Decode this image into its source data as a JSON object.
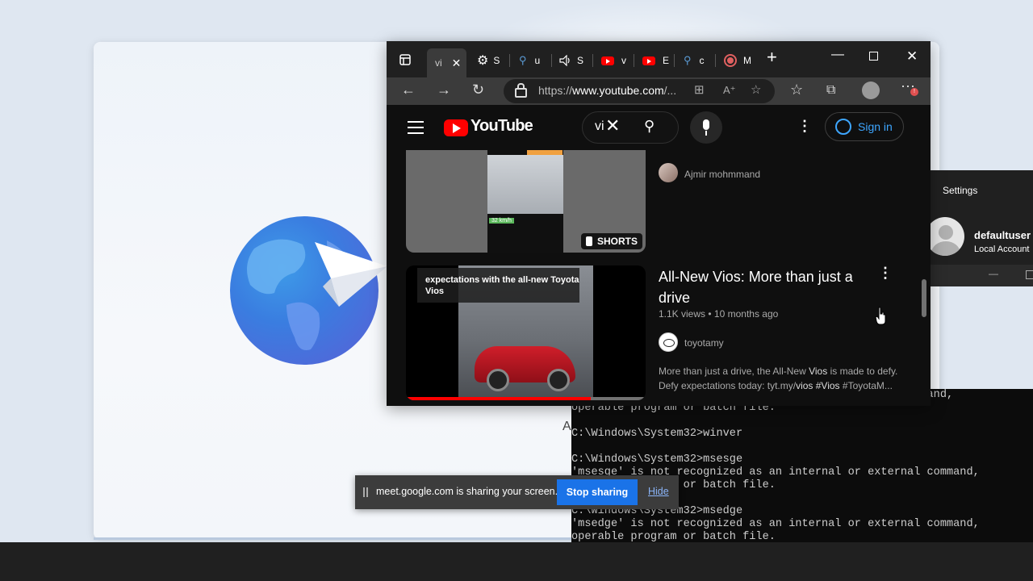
{
  "browser": {
    "tabs": [
      {
        "label": "vi",
        "icon": "youtube-tab-favicon",
        "active": true
      },
      {
        "label": "S",
        "icon": "gear-icon"
      },
      {
        "label": "u",
        "icon": "search-icon"
      },
      {
        "label": "S",
        "icon": "speaker-icon"
      },
      {
        "label": "v",
        "icon": "youtube-icon"
      },
      {
        "label": "E",
        "icon": "youtube-icon"
      },
      {
        "label": "c",
        "icon": "search-icon"
      },
      {
        "label": "M",
        "icon": "record-icon"
      }
    ],
    "address": {
      "prefix": "https://",
      "host": "www.youtube.com",
      "rest": "/..."
    }
  },
  "youtube": {
    "logo_text": "YouTube",
    "search_query": "vi",
    "signin_label": "Sign in",
    "videos": [
      {
        "channel": "Ajmir mohmmand",
        "badge": "SHORTS",
        "speed_label": "32 km/h"
      },
      {
        "title": "All-New Vios: More than just a drive",
        "views": "1.1K views",
        "age": "10 months ago",
        "meta_sep": "•",
        "channel": "toyotamy",
        "thumb_caption": "expectations with the all-new Toyota Vios",
        "description_1": "More than just a drive, the All-New ",
        "description_hl1": "Vios",
        "description_2": " is made to defy. Defy expectations today: tyt.my/",
        "description_hl2": "vios #Vios",
        "description_3": " #ToyotaM...",
        "progress": 0.77
      }
    ]
  },
  "settings": {
    "title": "Settings",
    "user_name": "defaultuser",
    "account_type": "Local Account"
  },
  "terminal": {
    "lines": [
      "                                                   ommand,",
      "operable program or batch file.",
      "",
      "C:\\Windows\\System32>winver",
      "",
      "C:\\Windows\\System32>msesge",
      "'msesge' is not recognized as an internal or external command,",
      "operable program or batch file.",
      "",
      "C:\\Windows\\System32>msedge",
      "'msedge' is not recognized as an internal or external command,",
      "operable program or batch file."
    ]
  },
  "desktop": {
    "stray_letter": "A"
  },
  "sharebar": {
    "message": "meet.google.com is sharing your screen.",
    "stop_label": "Stop sharing",
    "hide_label": "Hide"
  },
  "colors": {
    "accent": "#1a73e8",
    "youtube_red": "#ff0000",
    "link_blue": "#3ea6ff"
  }
}
